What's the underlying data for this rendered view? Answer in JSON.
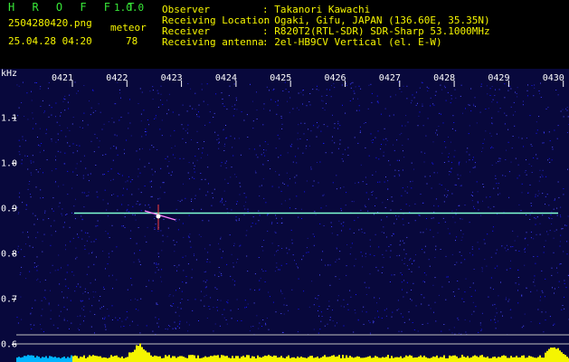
{
  "app": {
    "name": "H R O F F T",
    "version": "1.0.0",
    "filename": "2504280420.png",
    "datetime": "25.04.28 04:20",
    "meteor_label": "meteor",
    "meteor_count": "78"
  },
  "info": [
    {
      "label": "Observer",
      "value": ": Takanori Kawachi"
    },
    {
      "label": "Receiving Location",
      "value": ": Ogaki, Gifu, JAPAN (136.60E, 35.35N)"
    },
    {
      "label": "Receiver",
      "value": ": R820T2(RTL-SDR) SDR-Sharp 53.1000MHz"
    },
    {
      "label": "Receiving antenna",
      "value": ": 2el-HB9CV Vertical (el. E-W)"
    }
  ],
  "spectrogram": {
    "unit_label": "kHz",
    "time_labels": [
      "0421",
      "0422",
      "0423",
      "0424",
      "0425",
      "0426",
      "0427",
      "0428",
      "0429",
      "0430"
    ],
    "freq_labels": [
      "1.1",
      "1.0",
      "0.9",
      "0.8",
      "0.7",
      "0.6"
    ],
    "carrier_khz": 0.89,
    "colors": {
      "background": "#0a0a5a",
      "carrier": "#7fffd4",
      "tick": "#ffffff",
      "label_text": "#f5f500",
      "axis_text": "#ffffff"
    }
  }
}
